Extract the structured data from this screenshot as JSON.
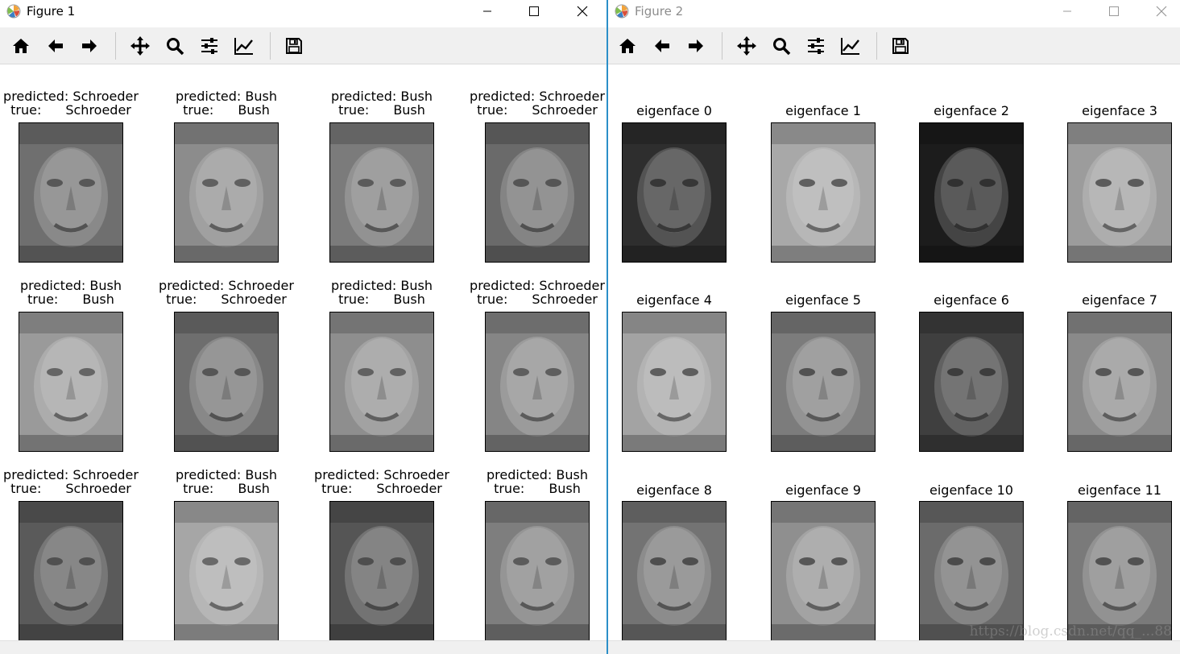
{
  "figure1": {
    "title": "Figure 1",
    "faces": [
      {
        "predicted_label": "predicted:",
        "predicted": "Schroeder",
        "true_label": "true:",
        "true": "Schroeder",
        "shade": "#6f6f6f"
      },
      {
        "predicted_label": "predicted:",
        "predicted": "Bush",
        "true_label": "true:",
        "true": "Bush",
        "shade": "#8c8c8c"
      },
      {
        "predicted_label": "predicted:",
        "predicted": "Bush",
        "true_label": "true:",
        "true": "Bush",
        "shade": "#7b7b7b"
      },
      {
        "predicted_label": "predicted:",
        "predicted": "Schroeder",
        "true_label": "true:",
        "true": "Schroeder",
        "shade": "#6a6a6a"
      },
      {
        "predicted_label": "predicted:",
        "predicted": "Bush",
        "true_label": "true:",
        "true": "Bush",
        "shade": "#9a9a9a"
      },
      {
        "predicted_label": "predicted:",
        "predicted": "Schroeder",
        "true_label": "true:",
        "true": "Schroeder",
        "shade": "#6e6e6e"
      },
      {
        "predicted_label": "predicted:",
        "predicted": "Bush",
        "true_label": "true:",
        "true": "Bush",
        "shade": "#8e8e8e"
      },
      {
        "predicted_label": "predicted:",
        "predicted": "Schroeder",
        "true_label": "true:",
        "true": "Schroeder",
        "shade": "#858585"
      },
      {
        "predicted_label": "predicted:",
        "predicted": "Schroeder",
        "true_label": "true:",
        "true": "Schroeder",
        "shade": "#5a5a5a"
      },
      {
        "predicted_label": "predicted:",
        "predicted": "Bush",
        "true_label": "true:",
        "true": "Bush",
        "shade": "#a6a6a6"
      },
      {
        "predicted_label": "predicted:",
        "predicted": "Schroeder",
        "true_label": "true:",
        "true": "Schroeder",
        "shade": "#555555"
      },
      {
        "predicted_label": "predicted:",
        "predicted": "Bush",
        "true_label": "true:",
        "true": "Bush",
        "shade": "#7e7e7e"
      }
    ]
  },
  "figure2": {
    "title": "Figure 2",
    "eigenfaces": [
      {
        "label": "eigenface 0",
        "shade": "#2e2e2e"
      },
      {
        "label": "eigenface 1",
        "shade": "#a8a8a8"
      },
      {
        "label": "eigenface 2",
        "shade": "#1c1c1c"
      },
      {
        "label": "eigenface 3",
        "shade": "#9c9c9c"
      },
      {
        "label": "eigenface 4",
        "shade": "#a3a3a3"
      },
      {
        "label": "eigenface 5",
        "shade": "#7c7c7c"
      },
      {
        "label": "eigenface 6",
        "shade": "#3f3f3f"
      },
      {
        "label": "eigenface 7",
        "shade": "#8a8a8a"
      },
      {
        "label": "eigenface 8",
        "shade": "#737373"
      },
      {
        "label": "eigenface 9",
        "shade": "#8f8f8f"
      },
      {
        "label": "eigenface 10",
        "shade": "#6b6b6b"
      },
      {
        "label": "eigenface 11",
        "shade": "#7a7a7a"
      }
    ]
  },
  "toolbar": {
    "icons": [
      "home-icon",
      "back-arrow-icon",
      "forward-arrow-icon",
      "pan-icon",
      "zoom-icon",
      "configure-subplots-icon",
      "edit-axis-icon",
      "save-icon"
    ]
  },
  "watermark": "https://blog.csdn.net/qq_...88",
  "colors": {
    "accent_border": "#2b8fc8",
    "toolbar_bg": "#f0f0f0"
  }
}
